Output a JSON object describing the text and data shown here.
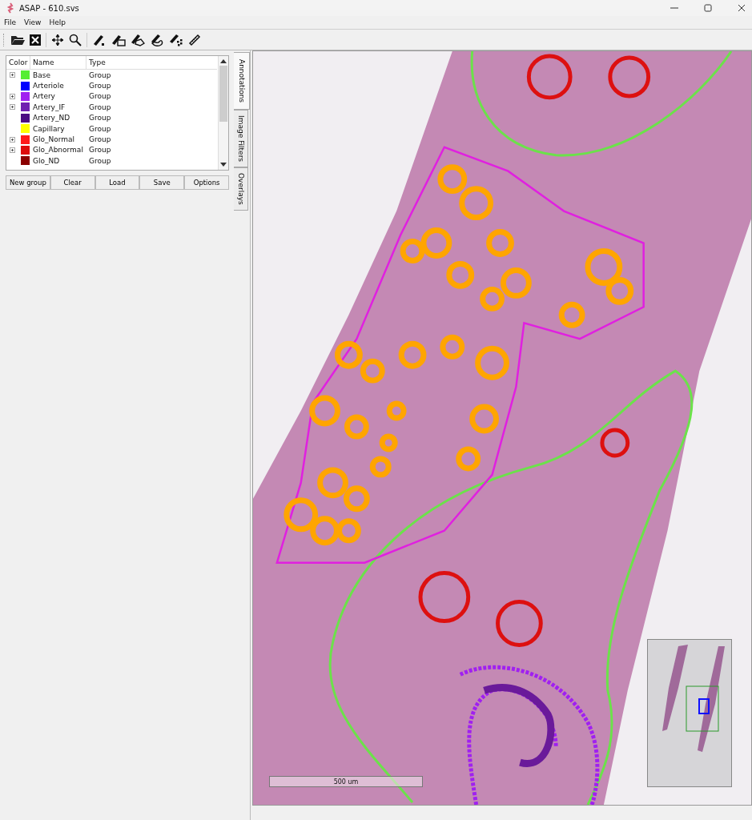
{
  "window": {
    "title": "ASAP - 610.svs"
  },
  "menu": [
    "File",
    "View",
    "Help"
  ],
  "annotations": {
    "columns": [
      "Color",
      "Name",
      "Type"
    ],
    "rows": [
      {
        "name": "Base",
        "type": "Group",
        "color": "#55ee33",
        "expandable": true
      },
      {
        "name": "Arteriole",
        "type": "Group",
        "color": "#0000ff",
        "expandable": false
      },
      {
        "name": "Artery",
        "type": "Group",
        "color": "#a020f0",
        "expandable": true
      },
      {
        "name": "Artery_IF",
        "type": "Group",
        "color": "#7020b0",
        "expandable": true
      },
      {
        "name": "Artery_ND",
        "type": "Group",
        "color": "#4b0c82",
        "expandable": false
      },
      {
        "name": "Capillary",
        "type": "Group",
        "color": "#ffff00",
        "expandable": false
      },
      {
        "name": "Glo_Normal",
        "type": "Group",
        "color": "#ff1a1a",
        "expandable": true
      },
      {
        "name": "Glo_Abnormal",
        "type": "Group",
        "color": "#dd0b0b",
        "expandable": true
      },
      {
        "name": "Glo_ND",
        "type": "Group",
        "color": "#8b0000",
        "expandable": false
      }
    ],
    "buttons": [
      "New group",
      "Clear",
      "Load",
      "Save",
      "Options"
    ]
  },
  "side_tabs": [
    {
      "label": "Annotations",
      "selected": true
    },
    {
      "label": "Image Filters",
      "selected": false
    },
    {
      "label": "Overlays",
      "selected": false
    }
  ],
  "viewer": {
    "scale_bar": "500 um"
  }
}
